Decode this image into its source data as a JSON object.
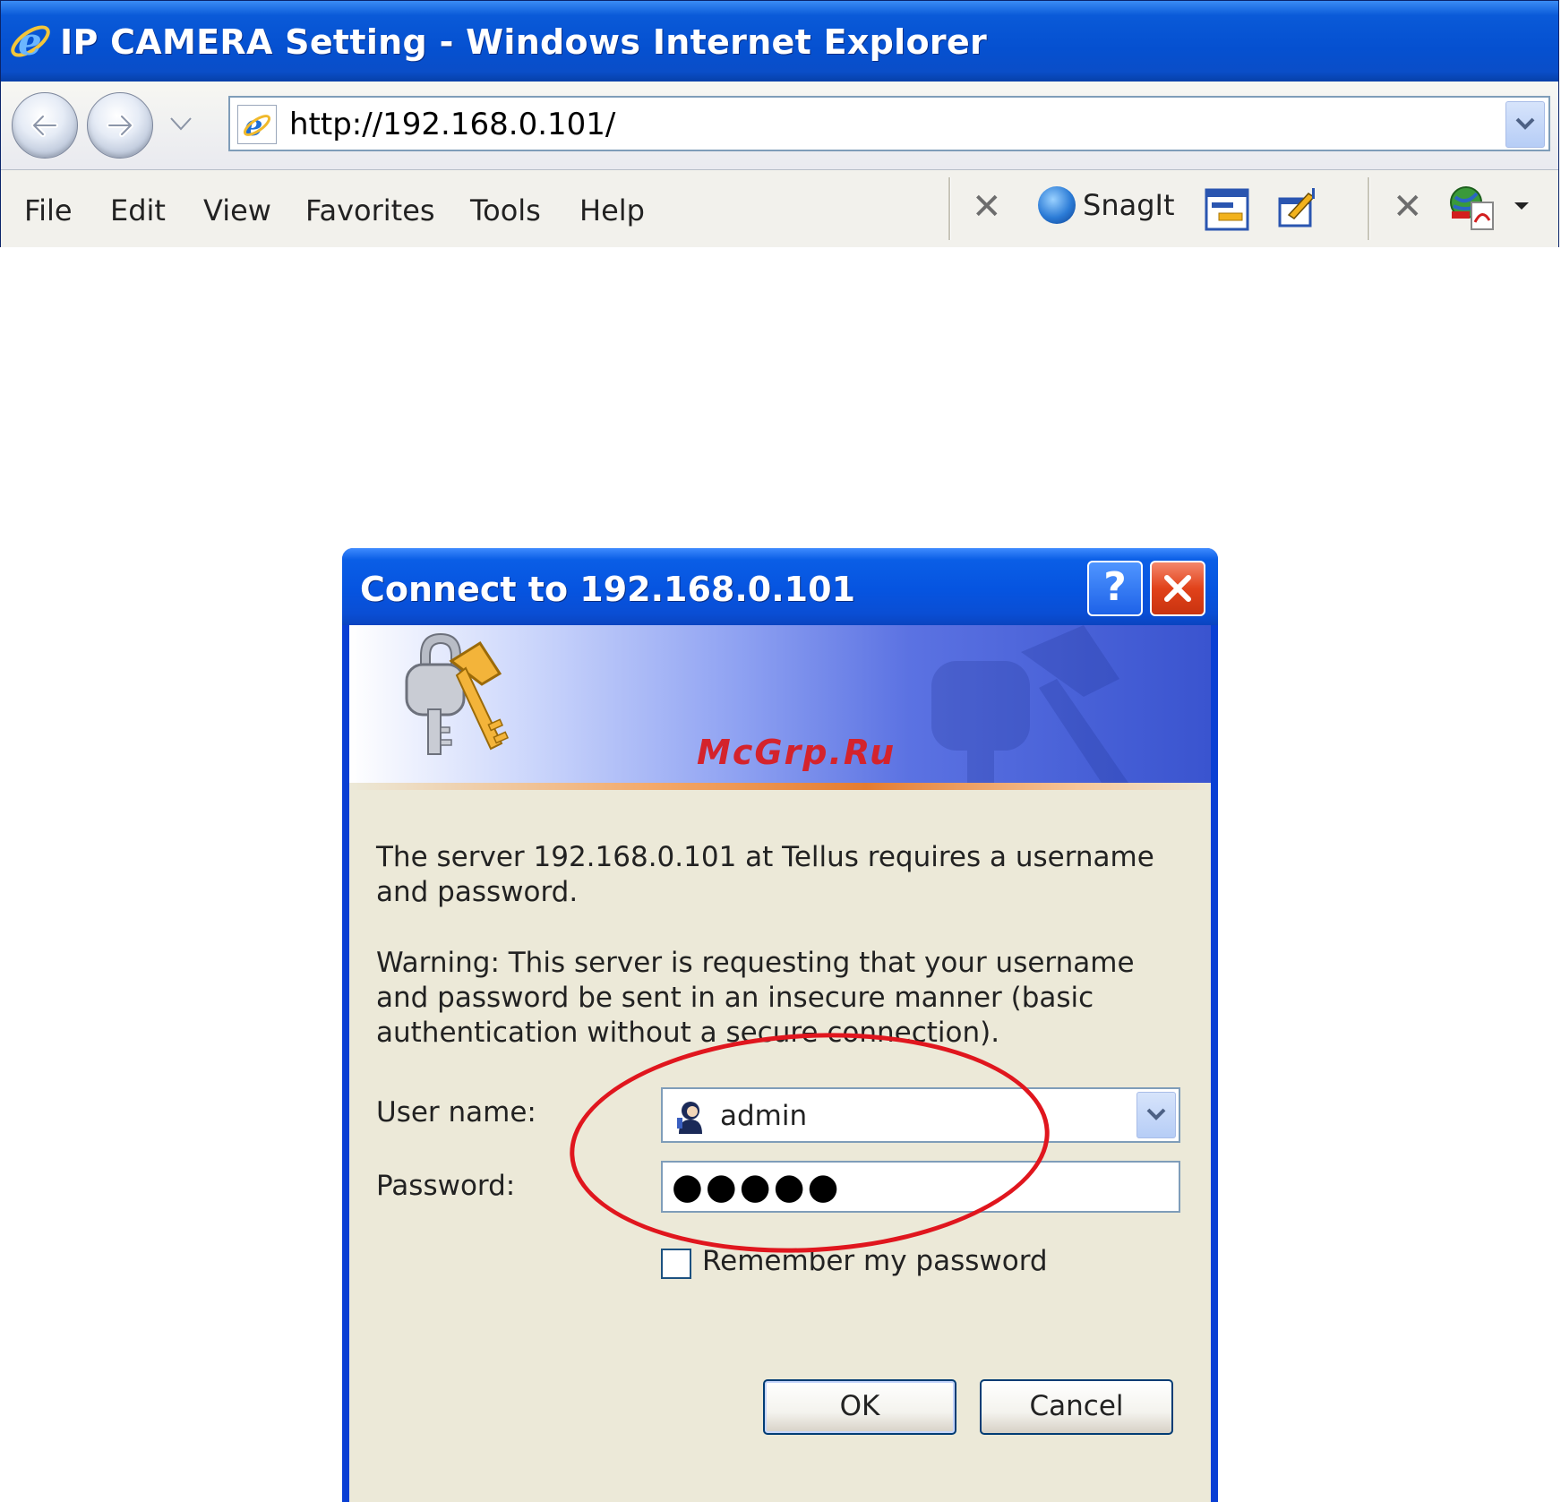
{
  "browser": {
    "title": "IP CAMERA Setting - Windows Internet Explorer",
    "address": "http://192.168.0.101/",
    "menu": [
      "File",
      "Edit",
      "View",
      "Favorites",
      "Tools",
      "Help"
    ],
    "toolbar": {
      "snagit_label": "SnagIt",
      "icons": [
        "ie-logo-icon",
        "back-arrow-icon",
        "forward-arrow-icon",
        "page-icon",
        "snagit-icon",
        "capture-window-icon",
        "capture-edit-icon",
        "web-to-pdf-icon"
      ]
    }
  },
  "dialog": {
    "title": "Connect to 192.168.0.101",
    "help_label": "?",
    "watermark": "McGrp.Ru",
    "server_message": "The server 192.168.0.101 at Tellus requires a username and password.",
    "warning_message": "Warning: This server is requesting that your username and password be sent in an insecure manner (basic authentication without a secure connection).",
    "username_label": "User name:",
    "username_value": "admin",
    "password_label": "Password:",
    "password_value": "●●●●●",
    "remember_label": "Remember my password",
    "remember_checked": false,
    "ok_label": "OK",
    "cancel_label": "Cancel"
  },
  "colors": {
    "titlebar_blue": "#0a5ad8",
    "dialog_body": "#ece9d8",
    "highlight_ellipse": "#e0161e",
    "watermark_red": "#d4232c"
  }
}
